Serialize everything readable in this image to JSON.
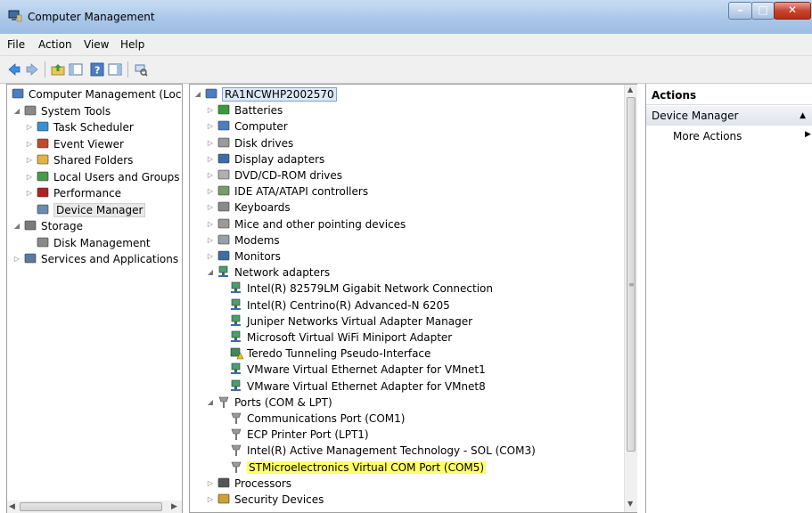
{
  "window": {
    "title": "Computer Management"
  },
  "menu": [
    "File",
    "Action",
    "View",
    "Help"
  ],
  "left_tree": [
    {
      "label": "Computer Management (Local",
      "indent": 0,
      "arrow": "",
      "icon": "computer-management-icon"
    },
    {
      "label": "System Tools",
      "indent": 1,
      "arrow": "expanded",
      "icon": "system-tools-icon"
    },
    {
      "label": "Task Scheduler",
      "indent": 2,
      "arrow": "collapsed",
      "icon": "clock-icon"
    },
    {
      "label": "Event Viewer",
      "indent": 2,
      "arrow": "collapsed",
      "icon": "event-viewer-icon"
    },
    {
      "label": "Shared Folders",
      "indent": 2,
      "arrow": "collapsed",
      "icon": "shared-folder-icon"
    },
    {
      "label": "Local Users and Groups",
      "indent": 2,
      "arrow": "collapsed",
      "icon": "users-icon"
    },
    {
      "label": "Performance",
      "indent": 2,
      "arrow": "collapsed",
      "icon": "performance-icon"
    },
    {
      "label": "Device Manager",
      "indent": 2,
      "arrow": "",
      "icon": "device-manager-icon",
      "selected": true
    },
    {
      "label": "Storage",
      "indent": 1,
      "arrow": "expanded",
      "icon": "storage-icon"
    },
    {
      "label": "Disk Management",
      "indent": 2,
      "arrow": "",
      "icon": "disk-management-icon"
    },
    {
      "label": "Services and Applications",
      "indent": 1,
      "arrow": "collapsed",
      "icon": "services-icon"
    }
  ],
  "device_tree": [
    {
      "label": "RA1NCWHP2002570",
      "indent": 0,
      "arrow": "expanded",
      "icon": "computer-icon",
      "root": true
    },
    {
      "label": "Batteries",
      "indent": 1,
      "arrow": "collapsed",
      "icon": "battery-icon"
    },
    {
      "label": "Computer",
      "indent": 1,
      "arrow": "collapsed",
      "icon": "computer-icon"
    },
    {
      "label": "Disk drives",
      "indent": 1,
      "arrow": "collapsed",
      "icon": "disk-drive-icon"
    },
    {
      "label": "Display adapters",
      "indent": 1,
      "arrow": "collapsed",
      "icon": "display-adapter-icon"
    },
    {
      "label": "DVD/CD-ROM drives",
      "indent": 1,
      "arrow": "collapsed",
      "icon": "dvd-drive-icon"
    },
    {
      "label": "IDE ATA/ATAPI controllers",
      "indent": 1,
      "arrow": "collapsed",
      "icon": "ide-controller-icon"
    },
    {
      "label": "Keyboards",
      "indent": 1,
      "arrow": "collapsed",
      "icon": "keyboard-icon"
    },
    {
      "label": "Mice and other pointing devices",
      "indent": 1,
      "arrow": "collapsed",
      "icon": "mouse-icon"
    },
    {
      "label": "Modems",
      "indent": 1,
      "arrow": "collapsed",
      "icon": "modem-icon"
    },
    {
      "label": "Monitors",
      "indent": 1,
      "arrow": "collapsed",
      "icon": "monitor-icon"
    },
    {
      "label": "Network adapters",
      "indent": 1,
      "arrow": "expanded",
      "icon": "network-adapter-icon"
    },
    {
      "label": "Intel(R) 82579LM Gigabit Network Connection",
      "indent": 2,
      "arrow": "",
      "icon": "network-adapter-icon"
    },
    {
      "label": "Intel(R) Centrino(R) Advanced-N 6205",
      "indent": 2,
      "arrow": "",
      "icon": "network-adapter-icon"
    },
    {
      "label": "Juniper Networks Virtual Adapter Manager",
      "indent": 2,
      "arrow": "",
      "icon": "network-adapter-icon"
    },
    {
      "label": "Microsoft Virtual WiFi Miniport Adapter",
      "indent": 2,
      "arrow": "",
      "icon": "network-adapter-icon"
    },
    {
      "label": "Teredo Tunneling Pseudo-Interface",
      "indent": 2,
      "arrow": "",
      "icon": "network-adapter-warning-icon"
    },
    {
      "label": "VMware Virtual Ethernet Adapter for VMnet1",
      "indent": 2,
      "arrow": "",
      "icon": "network-adapter-icon"
    },
    {
      "label": "VMware Virtual Ethernet Adapter for VMnet8",
      "indent": 2,
      "arrow": "",
      "icon": "network-adapter-icon"
    },
    {
      "label": "Ports (COM & LPT)",
      "indent": 1,
      "arrow": "expanded",
      "icon": "port-icon"
    },
    {
      "label": "Communications Port (COM1)",
      "indent": 2,
      "arrow": "",
      "icon": "port-icon"
    },
    {
      "label": "ECP Printer Port (LPT1)",
      "indent": 2,
      "arrow": "",
      "icon": "port-icon"
    },
    {
      "label": "Intel(R) Active Management Technology - SOL (COM3)",
      "indent": 2,
      "arrow": "",
      "icon": "port-icon"
    },
    {
      "label": "STMicroelectronics Virtual COM Port (COM5)",
      "indent": 2,
      "arrow": "",
      "icon": "port-icon",
      "highlighted": true
    },
    {
      "label": "Processors",
      "indent": 1,
      "arrow": "collapsed",
      "icon": "processor-icon"
    },
    {
      "label": "Security Devices",
      "indent": 1,
      "arrow": "collapsed",
      "icon": "security-device-icon"
    }
  ],
  "actions": {
    "header": "Actions",
    "section": "Device Manager",
    "item": "More Actions"
  },
  "colors": {
    "highlight": "#ffff66",
    "titlebar": "#a9c6e8",
    "close_button": "#c6452e"
  }
}
